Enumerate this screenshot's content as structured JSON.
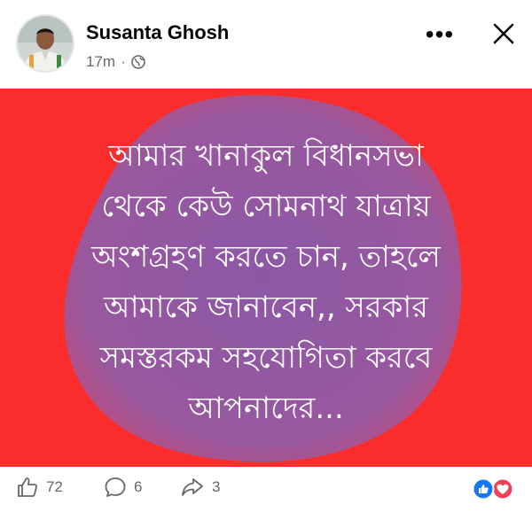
{
  "post": {
    "author_name": "Susanta Ghosh",
    "timestamp": "17m",
    "separator": "·",
    "privacy_icon": "globe-icon",
    "more_label": "•••",
    "text": "আমার খানাকুল বিধানসভা\nথেকে কেউ সোমনাথ যাত্রায়\nঅংশগ্রহণ করতে চান, তাহলে\nআমাকে জানাবেন,, সরকার\nসমস্তরকম সহযোগিতা করবে\nআপনাদের...",
    "background_color": "#fa2c2c",
    "blob_color": "#8c58a6"
  },
  "footer": {
    "like_count": "72",
    "comment_count": "6",
    "share_count": "3",
    "reaction_icons": [
      "like-reaction-icon",
      "love-reaction-icon"
    ]
  },
  "colors": {
    "meta_text": "#65676b",
    "like_blue": "#1877f2",
    "love_red": "#f33e58"
  }
}
